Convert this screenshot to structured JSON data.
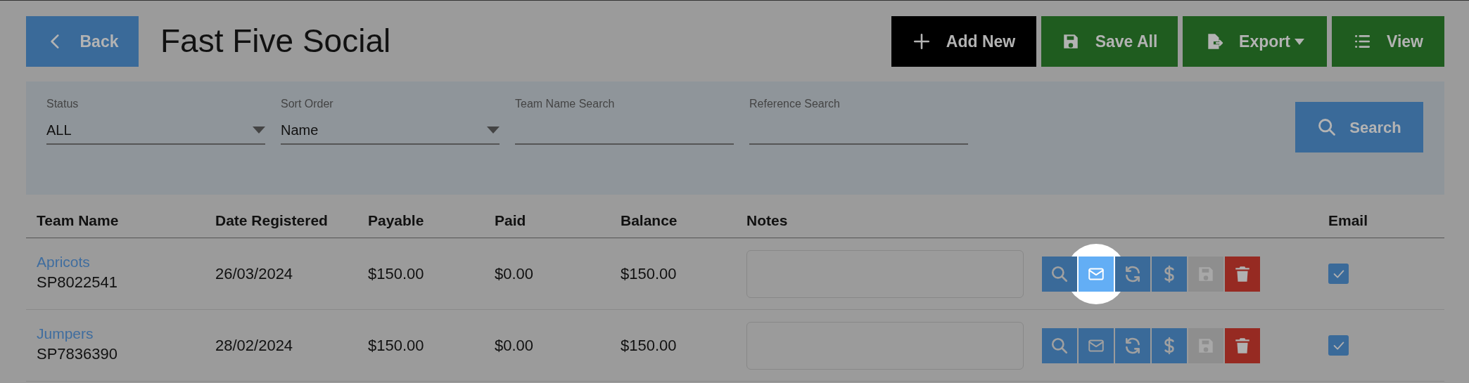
{
  "header": {
    "back_label": "Back",
    "title": "Fast Five Social",
    "buttons": [
      {
        "kind": "add",
        "label": "Add New"
      },
      {
        "kind": "save",
        "label": "Save All"
      },
      {
        "kind": "export",
        "label": "Export"
      },
      {
        "kind": "view",
        "label": "View"
      }
    ]
  },
  "filters": [
    {
      "kind": "select",
      "label": "Status",
      "value": "ALL"
    },
    {
      "kind": "select",
      "label": "Sort Order",
      "value": "Name"
    },
    {
      "kind": "text",
      "label": "Team Name Search"
    },
    {
      "kind": "text",
      "label": "Reference Search"
    }
  ],
  "search_button": "Search",
  "table": {
    "columns": [
      "Team Name",
      "Date Registered",
      "Payable",
      "Paid",
      "Balance",
      "Notes",
      "Email"
    ],
    "rows": [
      {
        "team": "Apricots",
        "reference": "SP8022541",
        "date": "26/03/2024",
        "payable": "$150.00",
        "paid": "$0.00",
        "balance": "$150.00",
        "email_checked": true,
        "actions": [
          {
            "kind": "view",
            "disabled": false,
            "highlighted": false
          },
          {
            "kind": "email",
            "disabled": false,
            "highlighted": true
          },
          {
            "kind": "refresh",
            "disabled": false,
            "highlighted": false
          },
          {
            "kind": "payment",
            "disabled": false,
            "highlighted": false
          },
          {
            "kind": "save",
            "disabled": true,
            "highlighted": false
          },
          {
            "kind": "delete",
            "disabled": false,
            "highlighted": false
          }
        ]
      },
      {
        "team": "Jumpers",
        "reference": "SP7836390",
        "date": "28/02/2024",
        "payable": "$150.00",
        "paid": "$0.00",
        "balance": "$150.00",
        "email_checked": true,
        "actions": [
          {
            "kind": "view",
            "disabled": false,
            "highlighted": false
          },
          {
            "kind": "email",
            "disabled": false,
            "highlighted": false
          },
          {
            "kind": "refresh",
            "disabled": false,
            "highlighted": false
          },
          {
            "kind": "payment",
            "disabled": false,
            "highlighted": false
          },
          {
            "kind": "save",
            "disabled": true,
            "highlighted": false
          },
          {
            "kind": "delete",
            "disabled": false,
            "highlighted": false
          }
        ]
      }
    ]
  }
}
